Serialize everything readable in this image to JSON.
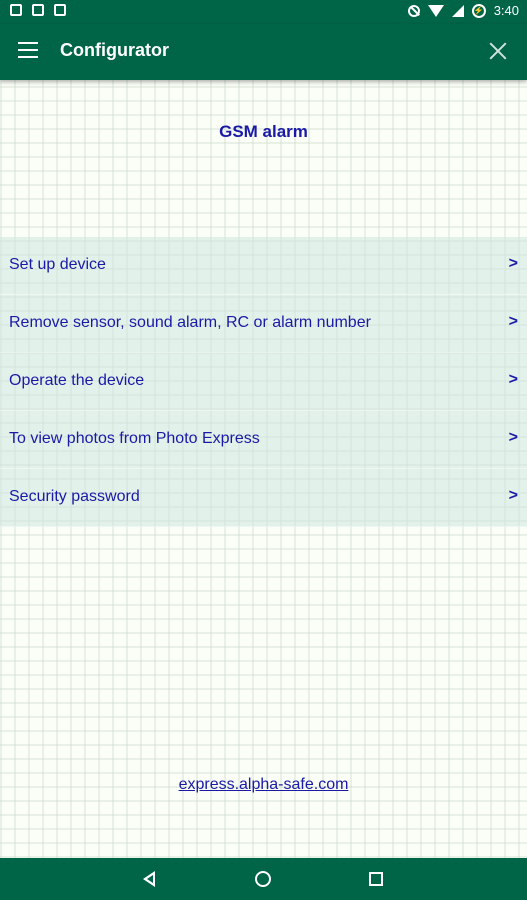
{
  "status_bar": {
    "time": "3:40",
    "icons": [
      "message-icon",
      "image-icon",
      "android-icon",
      "do-not-disturb-icon",
      "wifi-icon",
      "signal-icon",
      "battery-charging-icon"
    ]
  },
  "app_bar": {
    "title": "Configurator",
    "menu_icon": "hamburger-icon",
    "close_icon": "close-icon"
  },
  "main": {
    "heading": "GSM alarm",
    "menu_items": [
      {
        "label": "Set up device",
        "arrow": ">"
      },
      {
        "label": "Remove sensor, sound alarm, RC or alarm number",
        "arrow": ">"
      },
      {
        "label": "Operate the device",
        "arrow": ">"
      },
      {
        "label": "To view photos from Photo Express",
        "arrow": ">"
      },
      {
        "label": "Security password",
        "arrow": ">"
      }
    ],
    "footer_link": "express.alpha-safe.com"
  },
  "nav_bar": {
    "buttons": [
      "back-icon",
      "home-icon",
      "recents-icon"
    ]
  },
  "colors": {
    "primary": "#006446",
    "text_accent": "#1a1aa6",
    "menu_bg": "#d0e8e1"
  }
}
